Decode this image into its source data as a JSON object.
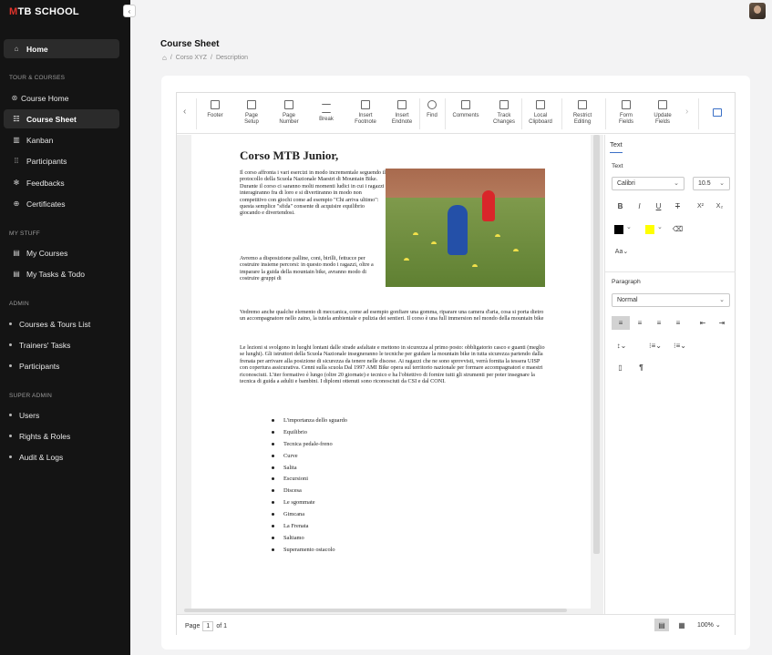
{
  "app": {
    "logo_prefix": "M",
    "logo_text": "TB SCHOOL"
  },
  "sidebar": {
    "collapse_icon": "‹",
    "home": "Home",
    "sections": [
      {
        "title": "TOUR & COURSES",
        "items": [
          "Course Home",
          "Course Sheet",
          "Kanban",
          "Participants",
          "Feedbacks",
          "Certificates"
        ]
      },
      {
        "title": "MY STUFF",
        "items": [
          "My Courses",
          "My Tasks & Todo"
        ]
      },
      {
        "title": "ADMIN",
        "items": [
          "Courses & Tours List",
          "Trainers' Tasks",
          "Participants"
        ]
      },
      {
        "title": "SUPER ADMIN",
        "items": [
          "Users",
          "Rights & Roles",
          "Audit & Logs"
        ]
      }
    ],
    "active_item": "Course Sheet"
  },
  "page": {
    "title": "Course Sheet",
    "breadcrumb": [
      "Corso XYZ",
      "Description"
    ]
  },
  "toolbar": [
    "Footer",
    "Page Setup",
    "Page Number",
    "Break",
    "Insert Footnote",
    "Insert Endnote",
    "Find",
    "Comments",
    "Track Changes",
    "Local Clipboard",
    "Restrict Editing",
    "Form Fields",
    "Update Fields"
  ],
  "document": {
    "heading": "Corso MTB Junior,",
    "p1": "Il corso affronta i vari esercizi in modo incrementale seguendo il protocollo della Scuola Nazionale Maestri di Mountain Bike. Durante il corso ci saranno molti momenti ludici in cui i ragazzi interagiranno fra di loro e si divertiranno in modo non competitivo con giochi come ad esempio \"Chi arriva ultimo\": questa semplice \"sfida\" consente di acquisire equilibrio giocando e divertendosi.",
    "p2": "Avremo a disposizione palline, coni, birilli, fettucce per costruire insieme percorsi: in questo modo i ragazzi, oltre a imparare la guida della mountain bike, avranno modo di costruire gruppi di",
    "p3": "Vedremo anche qualche elemento di meccanica, come ad esempio gonfiare una gomma, riparare una camera d'aria, cosa si porta dietro un accompagnatore nello zaino, la tutela ambientale e pulizia dei sentieri. Il corso è una full immersion nel mondo della mountain bike",
    "p4": "Le lezioni si svolgono in luoghi lontani dalle strade asfaltate e mettono in sicurezza al primo posto: obbligatorio casco e guanti (meglio se lunghi). Gli istruttori della Scuola Nazionale insegneranno le tecniche per guidare la mountain bike in tutta sicurezza partendo dalla frenata per arrivare alla posizione di sicurezza da tenere nelle discese. Ai ragazzi che ne sono sprovvisti, verrà fornita la tessera UISP con copertura assicurativa. Cenni sulla scuola Dal 1997 AMI Bike opera sul territorio nazionale per formare accompagnatori e maestri riconosciuti. L'iter formativo è lungo (oltre 20 giornate) e tecnico e ha l'obiettivo di fornire tutti gli strumenti per poter insegnare la tecnica di guida a adulti e bambini. I diplomi ottenuti sono riconosciuti da CSI e dal CONI.",
    "bullets": [
      "L'importanza dello sguardo",
      "Equilibrio",
      "Tecnica pedale-freno",
      "Curve",
      "Salita",
      "Escursioni",
      "Discesa",
      "Le sgommate",
      "Gimcana",
      "La Frenata",
      "Saltiamo",
      "Superamento ostacolo"
    ]
  },
  "props": {
    "tab": "Text",
    "text_label": "Text",
    "font": "Calibri",
    "size": "10.5",
    "paragraph_label": "Paragraph",
    "style": "Normal",
    "font_color": "#000000",
    "highlight_color": "#ffff00"
  },
  "status": {
    "page_label": "Page",
    "page": "1",
    "of_label": "of",
    "total": "1",
    "zoom": "100%"
  }
}
